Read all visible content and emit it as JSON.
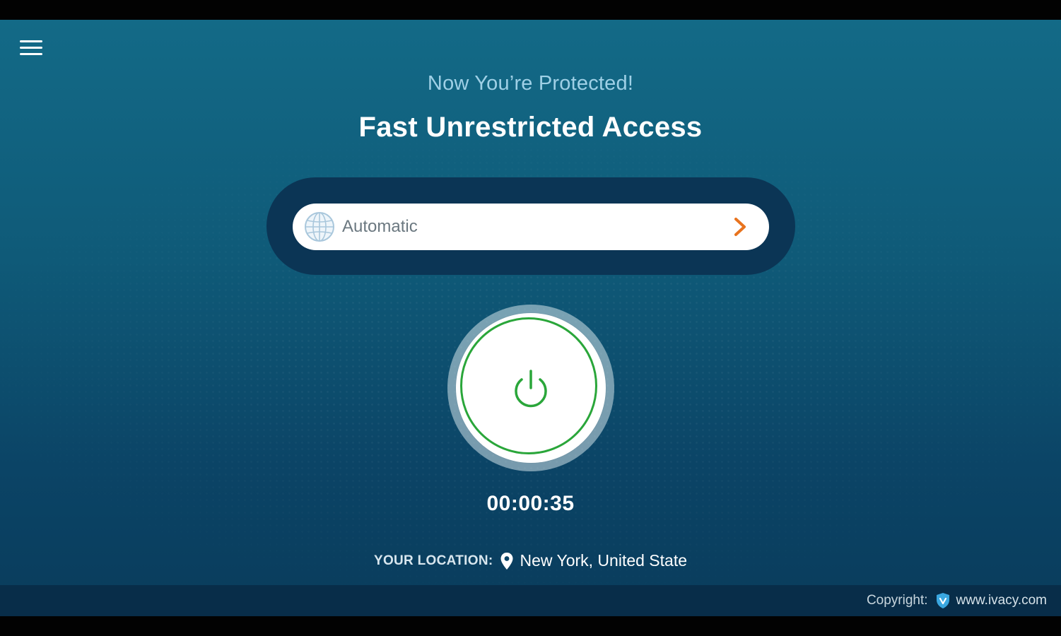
{
  "header": {
    "menu_icon": "hamburger-menu-icon",
    "subtitle": "Now You’re Protected!",
    "title": "Fast Unrestricted Access"
  },
  "server_selector": {
    "value": "Automatic",
    "leading_icon": "globe-icon",
    "trailing_icon": "chevron-right-icon",
    "chevron_color": "#e8731e"
  },
  "connection": {
    "power_icon": "power-icon",
    "status_color": "#2aa63a",
    "timer": "00:00:35"
  },
  "location": {
    "label": "YOUR LOCATION:",
    "icon": "location-pin-icon",
    "value": "New York, United State"
  },
  "footer": {
    "copyright_label": "Copyright:",
    "brand_icon": "shield-logo-icon",
    "website": "www.ivacy.com"
  }
}
